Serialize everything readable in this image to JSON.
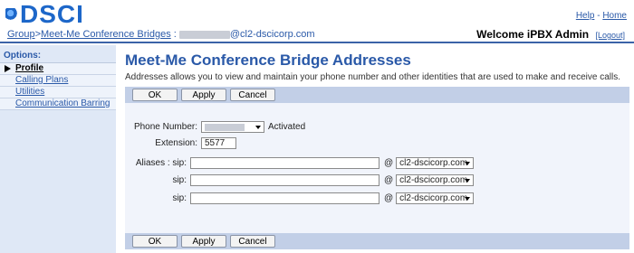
{
  "brand": {
    "logo_text": "DSCI"
  },
  "top_links": {
    "help": "Help",
    "separator": "-",
    "home": "Home"
  },
  "breadcrumb": {
    "group": "Group",
    "separator": ">",
    "section": "Meet-Me Conference Bridges",
    "colon": ":",
    "domain_suffix": "@cl2-dscicorp.com"
  },
  "header": {
    "welcome": "Welcome iPBX Admin",
    "logout": "[Logout]"
  },
  "sidebar": {
    "options_label": "Options:",
    "items": [
      {
        "label": "Profile",
        "active": true
      },
      {
        "label": "Calling Plans",
        "active": false
      },
      {
        "label": "Utilities",
        "active": false
      },
      {
        "label": "Communication Barring",
        "active": false
      }
    ]
  },
  "main": {
    "title": "Meet-Me Conference Bridge Addresses",
    "description": "Addresses allows you to view and maintain your phone number and other identities that are used to make and receive calls.",
    "buttons": {
      "ok": "OK",
      "apply": "Apply",
      "cancel": "Cancel"
    },
    "form": {
      "phone_number_label": "Phone Number:",
      "phone_status": "Activated",
      "extension_label": "Extension:",
      "extension_value": "5577",
      "aliases_label": "Aliases : sip:",
      "sip_label": "sip:",
      "at_sign": "@",
      "domain_option": "cl2-dscicorp.com"
    }
  },
  "colors": {
    "accent": "#2a59a8",
    "button_bar": "#c2cfe7",
    "sidebar_bg": "#dfe8f6",
    "panel_bg": "#f1f4fb"
  }
}
